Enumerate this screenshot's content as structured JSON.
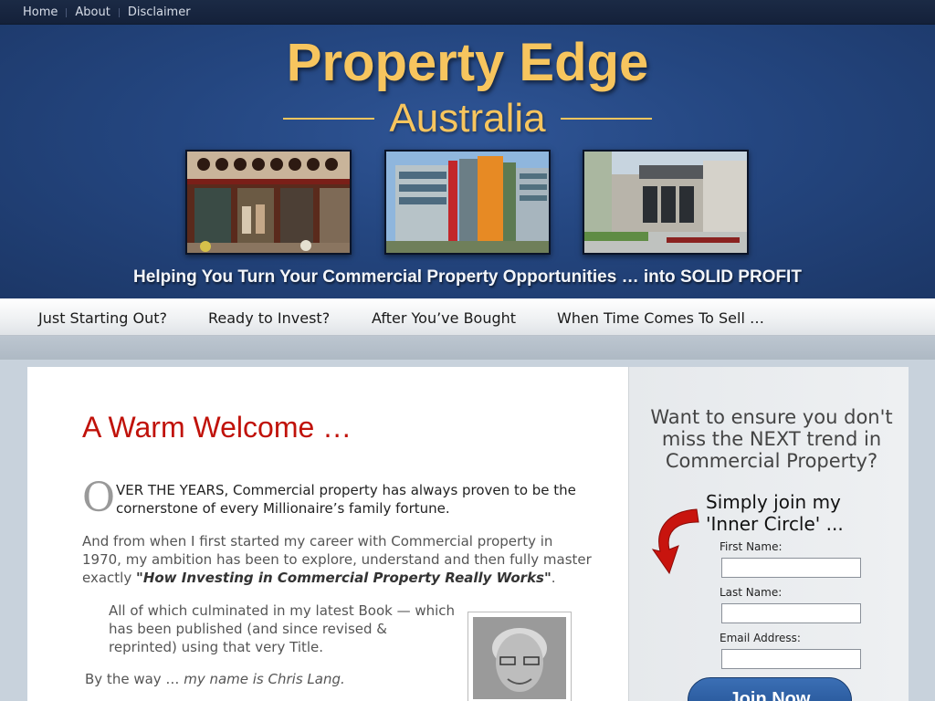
{
  "topnav": {
    "items": [
      "Home",
      "About",
      "Disclaimer"
    ]
  },
  "header": {
    "title": "Property Edge",
    "subtitle": "Australia",
    "tagline": "Helping You Turn Your Commercial Property Opportunities … into SOLID PROFIT"
  },
  "mainnav": {
    "items": [
      "Just Starting Out?",
      "Ready to Invest?",
      "After You’ve Bought",
      "When Time Comes To Sell …"
    ]
  },
  "content": {
    "heading": "A Warm Welcome …",
    "dropcap": "O",
    "p1": "VER THE YEARS, Commercial property has always proven to be the cornerstone of every Millionaire’s family fortune.",
    "p2_text": "And from when I first started my career with Commercial property in 1970, my ambition has been to explore, understand and then fully master exactly",
    "p2_emph": "\"How Investing in Commercial Property Really Works\"",
    "p2_end": ".",
    "p3": "All of which culminated in my latest Book — which has been published (and since revised & reprinted) using that very Title.",
    "p4_text": "By the way … ",
    "p4_emph": "my name is Chris Lang."
  },
  "sidebar": {
    "heading": "Want to ensure you don't miss the NEXT trend in Commercial Property?",
    "join_title": "Simply join my 'Inner Circle' ...",
    "first_name_label": "First Name:",
    "last_name_label": "Last Name:",
    "email_label": "Email Address:",
    "first_name_value": "",
    "last_name_value": "",
    "email_value": "",
    "button_label": "Join Now"
  },
  "colors": {
    "title_gold": "#f7c55e",
    "header_blue": "#244680",
    "heading_red": "#c0120a",
    "button_blue": "#2a5ca0"
  }
}
